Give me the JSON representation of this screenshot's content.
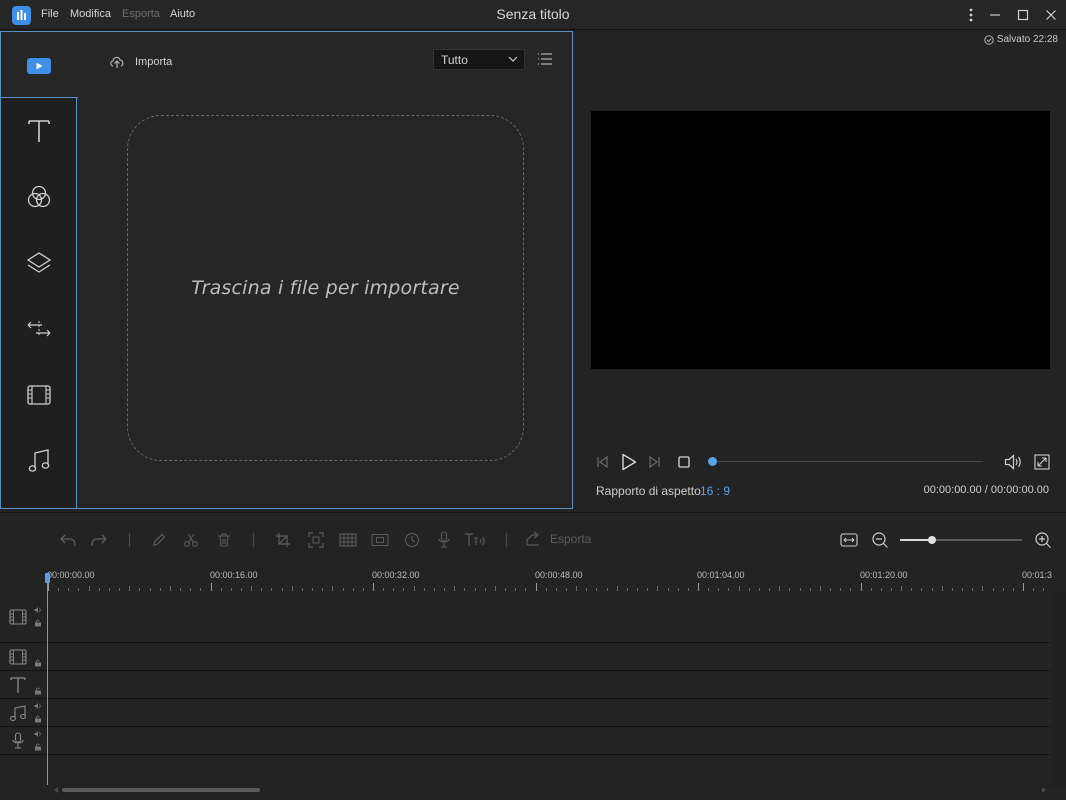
{
  "app": {
    "title": "Senza titolo",
    "menu": [
      "File",
      "Modifica",
      "Esporta",
      "Aiuto"
    ],
    "menu_disabled": [
      false,
      false,
      true,
      false
    ]
  },
  "media_panel": {
    "import_label": "Importa",
    "filter_value": "Tutto",
    "drop_text": "Trascina i file per importare",
    "nav_items": [
      "media-icon",
      "text-icon",
      "filters-icon",
      "overlays-icon",
      "transitions-icon",
      "elements-icon",
      "music-icon"
    ]
  },
  "preview": {
    "saved_status": "Salvato 22:28",
    "aspect_label": "Rapporto di aspetto",
    "aspect_value": "16 : 9",
    "time_display": "00:00:00.00 / 00:00:00.00",
    "progress": 0
  },
  "timeline": {
    "export_label": "Esporta",
    "ruler_labels": [
      "00:00:00.00",
      "00:00:16.00",
      "00:00:32.00",
      "00:00:48.00",
      "00:01:04.00",
      "00:01:20.00",
      "00:01:3"
    ],
    "zoom_level": 0.26
  },
  "colors": {
    "accent": "#5aa2e8",
    "panel_border": "#5a8fc4",
    "background": "#232323"
  }
}
